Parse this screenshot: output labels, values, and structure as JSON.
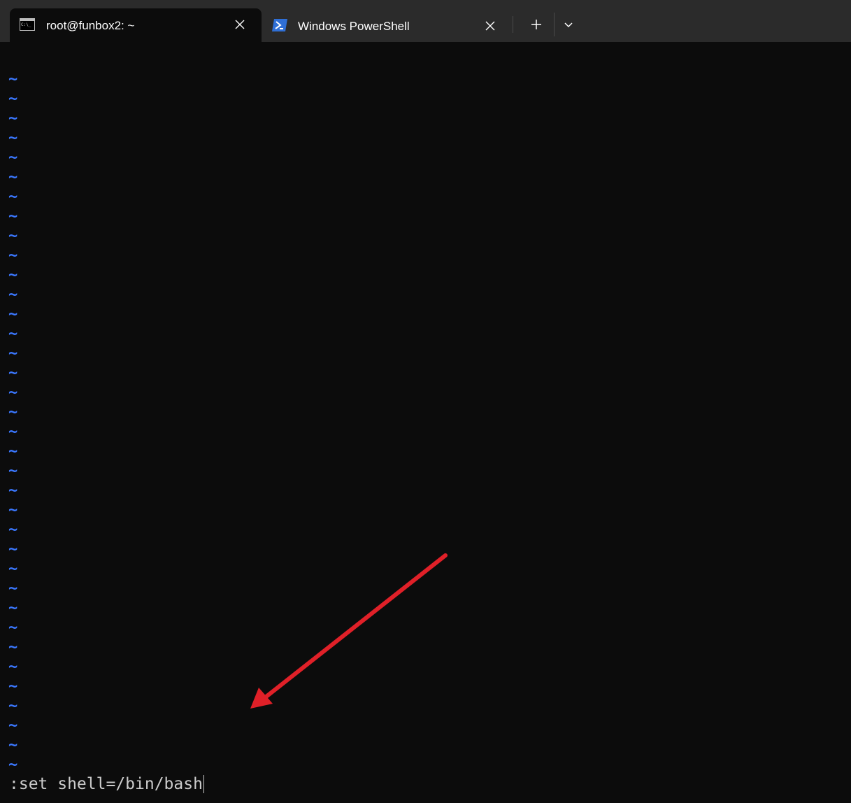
{
  "tabs": [
    {
      "title": "root@funbox2: ~",
      "icon": "cmd-icon",
      "active": true
    },
    {
      "title": "Windows PowerShell",
      "icon": "powershell-icon",
      "active": false
    }
  ],
  "terminal": {
    "empty_line_marker": "~",
    "empty_line_count": 36,
    "command_line": ":set shell=/bin/bash"
  },
  "colors": {
    "background": "#0c0c0c",
    "tabbar": "#2b2b2b",
    "tilde": "#3b78ff",
    "text": "#cccccc",
    "annotation_arrow": "#e02028"
  }
}
